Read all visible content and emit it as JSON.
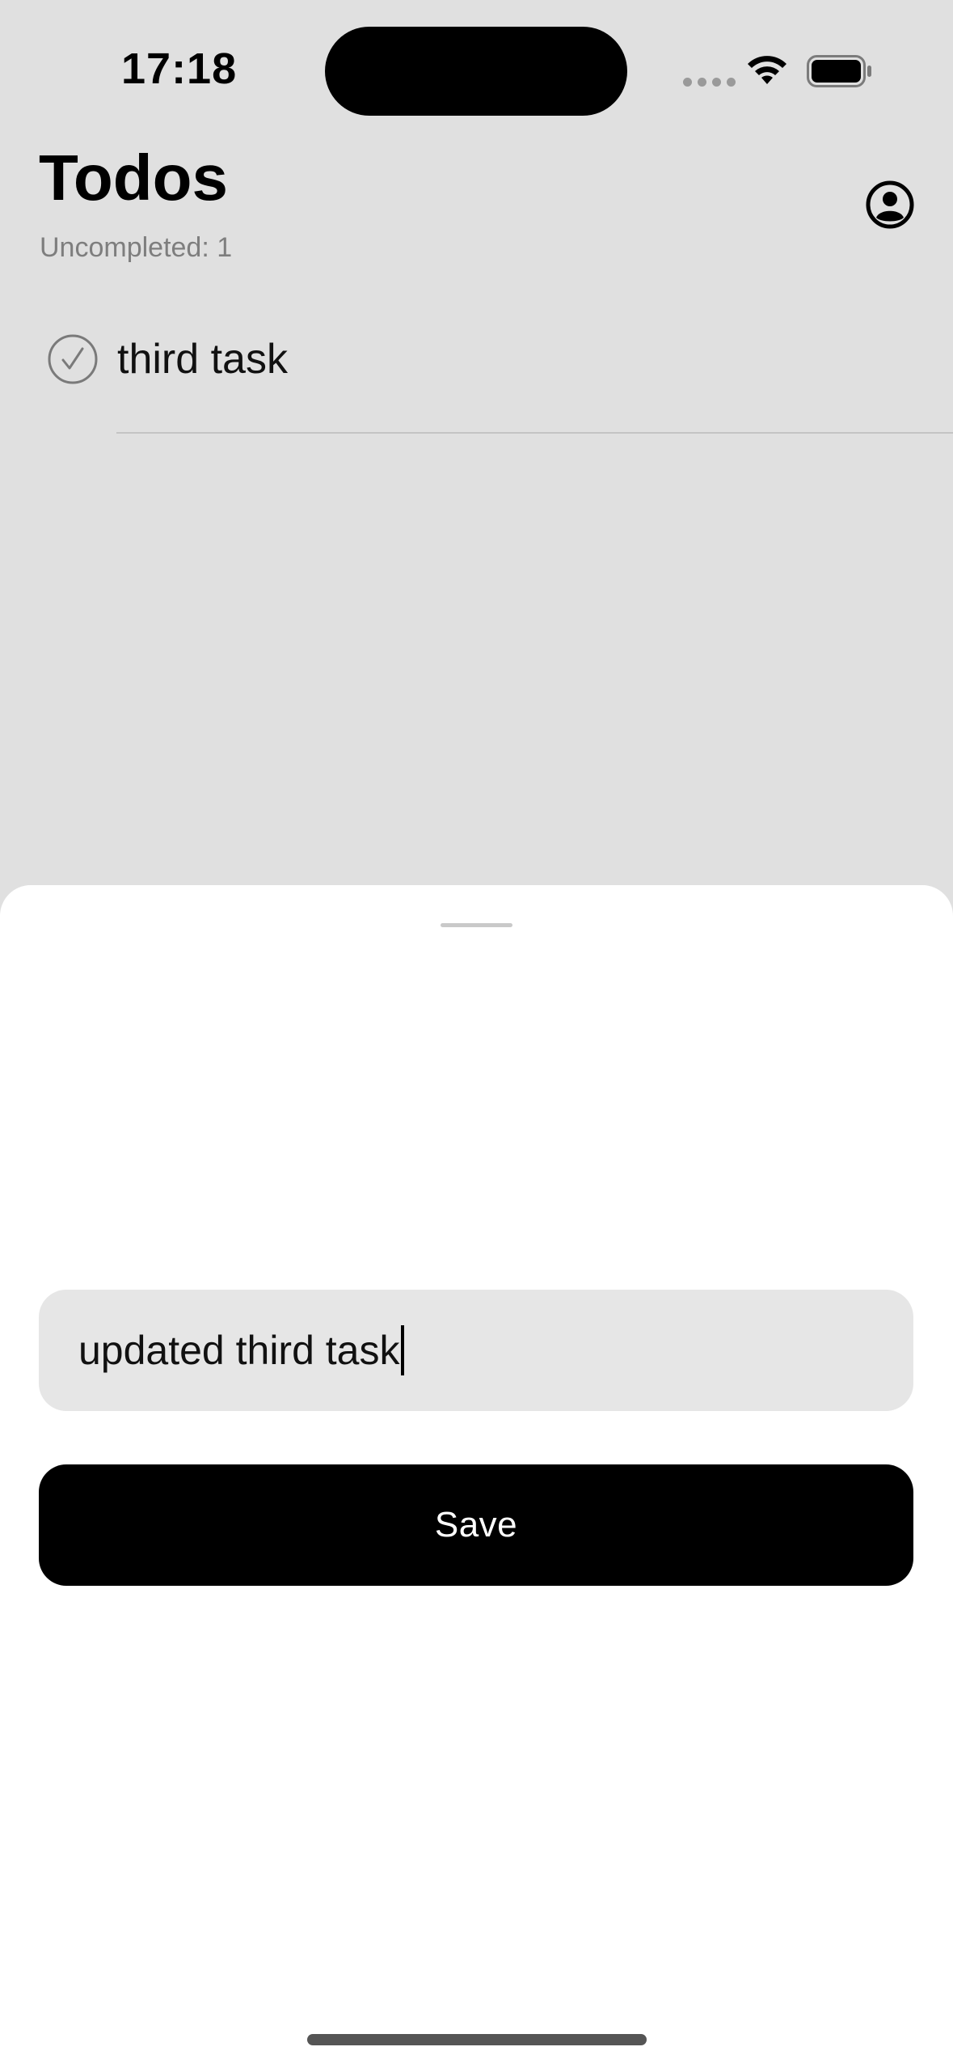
{
  "status_bar": {
    "time": "17:18",
    "wifi_icon": "wifi-icon",
    "battery_icon": "battery-icon"
  },
  "header": {
    "title": "Todos",
    "subtitle": "Uncompleted: 1",
    "profile_icon": "person-circle-icon"
  },
  "todos": [
    {
      "label": "third task",
      "completed": false,
      "icon": "checkmark-circle-icon"
    }
  ],
  "edit_sheet": {
    "input_value": "updated third task",
    "save_label": "Save"
  },
  "colors": {
    "background": "#e0e0e0",
    "sheet": "#ffffff",
    "field": "#e6e6e6",
    "button": "#000000",
    "button_text": "#ffffff",
    "subtitle": "#7e7e7e"
  }
}
